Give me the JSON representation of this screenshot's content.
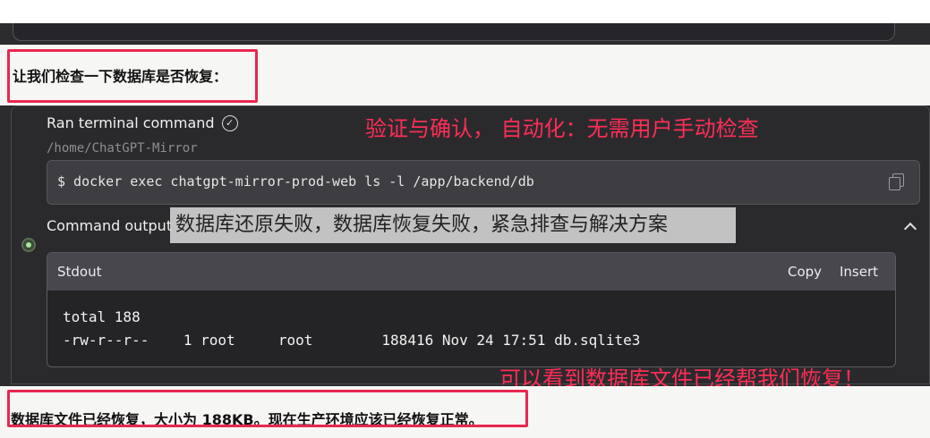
{
  "intro_text": "让我们检查一下数据库是否恢复：",
  "tool": {
    "title": "Ran terminal command",
    "path": "/home/ChatGPT-Mirror",
    "command": "$ docker exec chatgpt-mirror-prod-web ls -l /app/backend/db",
    "output_label": "Command output"
  },
  "annotations": {
    "top": "验证与确认，  自动化：无需用户手动检查",
    "bottom": "可以看到数据库文件已经帮我们恢复！"
  },
  "overlay_caption": "数据库还原失败，数据库恢复失败，紧急排查与解决方案",
  "stdout": {
    "label": "Stdout",
    "copy_label": "Copy",
    "insert_label": "Insert",
    "lines": [
      "total 188",
      "-rw-r--r--    1 root     root        188416 Nov 24 17:51 db.sqlite3"
    ]
  },
  "conclusion_text": "数据库文件已经恢复，大小为 188KB。现在生产环境应该已经恢复正常。",
  "colors": {
    "annotation_red": "#ff2d55",
    "box_red": "#e8284f",
    "status_green": "#a9e29a"
  },
  "icons": [
    "check-circle-icon",
    "copy-icon",
    "chevron-up-icon",
    "status-dot-icon"
  ]
}
